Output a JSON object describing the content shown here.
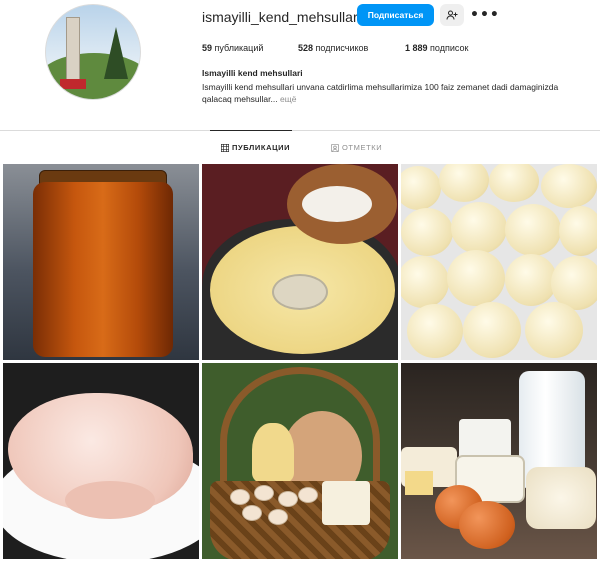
{
  "profile": {
    "username": "ismayilli_kend_mehsullari",
    "follow_label": "Подписаться",
    "avatar_sign_text": "ISMAYILLI",
    "avatar_sign_subtext": "ŞƏHƏRİ",
    "full_name": "Ismayilli kend mehsullari",
    "bio": "Ismayilli kend mehsullari unvana catdirlima mehsullarimiza 100 faiz zemanet dadi damaginizda qalacaq mehsullar...",
    "bio_more": " ещё"
  },
  "stats": {
    "posts_count": "59",
    "posts_label": " публикаций",
    "followers_count": "528",
    "followers_label": " подписчиков",
    "following_count": "1 889",
    "following_label": " подписок"
  },
  "tabs": {
    "posts": "ПУБЛИКАЦИИ",
    "tagged": "ОТМЕТКИ"
  },
  "icons": {
    "suggest": "person-plus-icon",
    "more": "more-dots-icon",
    "posts_tab": "grid-icon",
    "tagged_tab": "tag-icon"
  },
  "colors": {
    "accent": "#0095f6",
    "text": "#262626",
    "muted": "#8e8e8e",
    "divider": "#dbdbdb"
  },
  "posts": [
    {
      "subject": "honey jar"
    },
    {
      "subject": "milk pot with flour"
    },
    {
      "subject": "dough balls"
    },
    {
      "subject": "raw chicken"
    },
    {
      "subject": "basket of farm products"
    },
    {
      "subject": "dairy products and eggs"
    }
  ]
}
